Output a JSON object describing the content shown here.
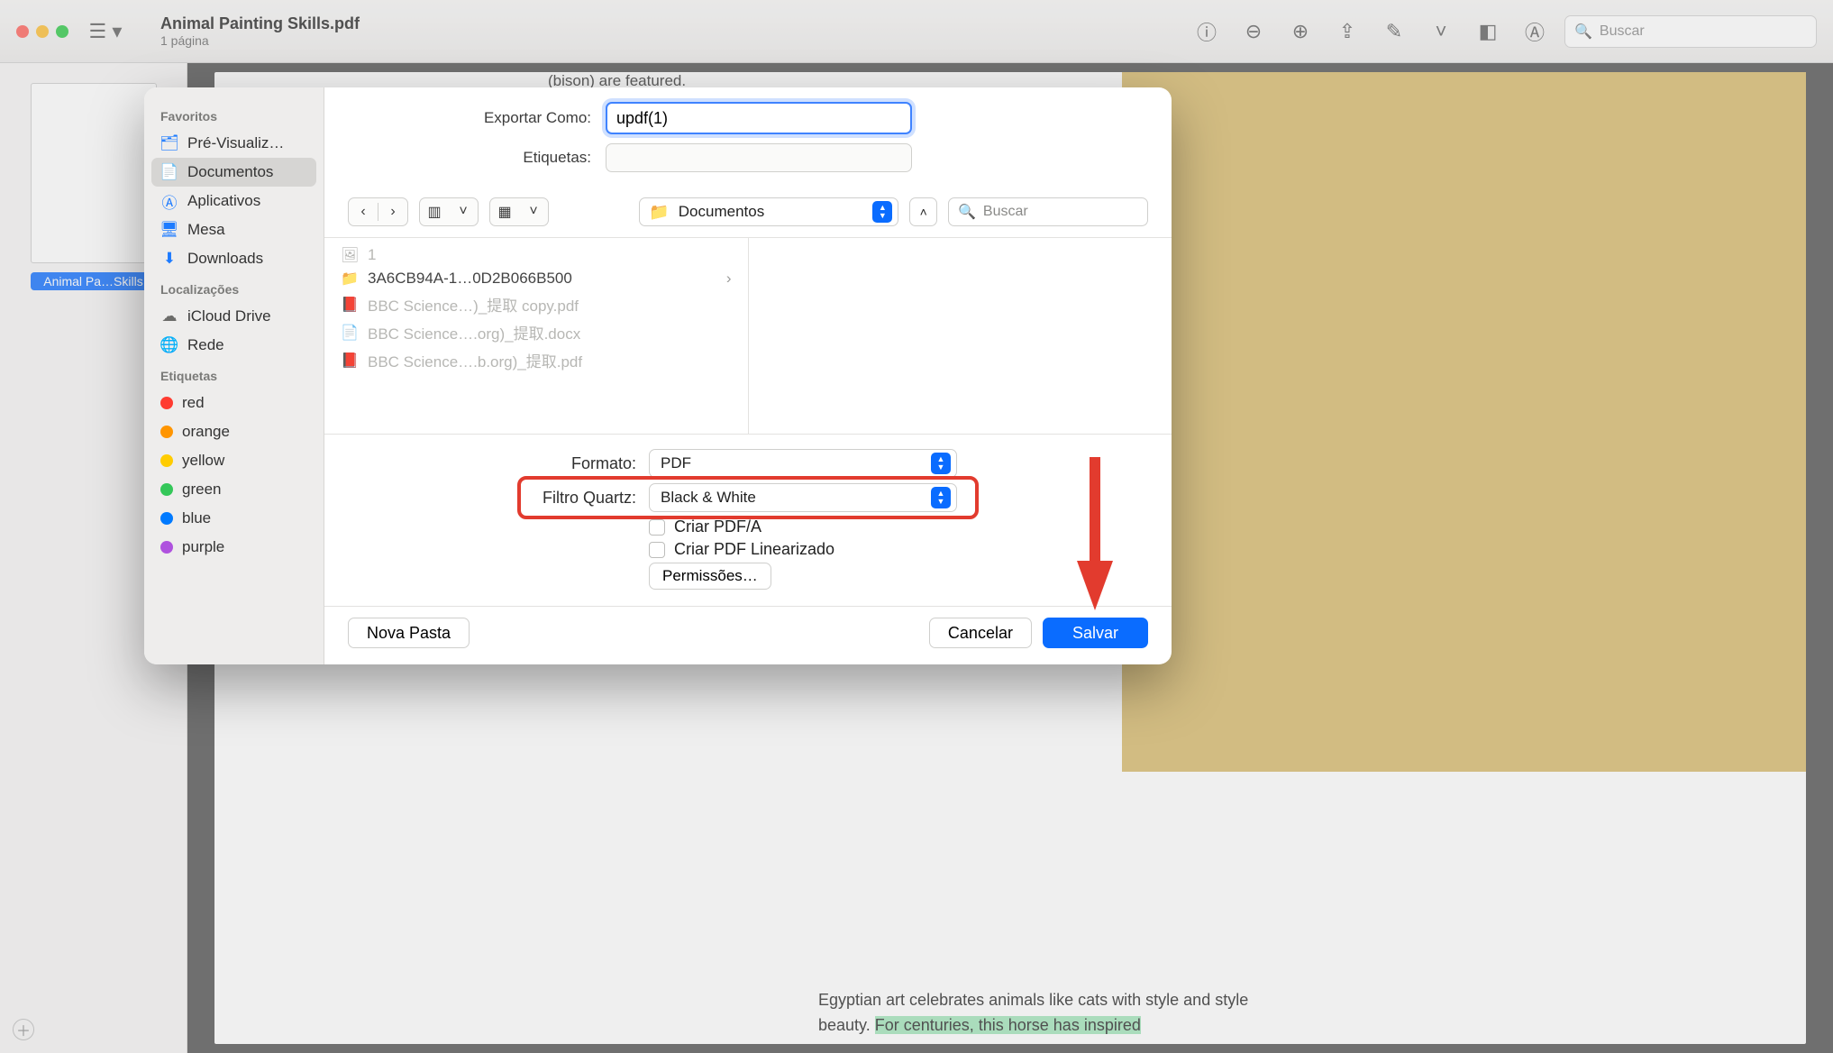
{
  "window": {
    "title": "Animal Painting Skills.pdf",
    "subtitle": "1 página",
    "search_placeholder": "Buscar",
    "thumb_label": "Animal Pa…Skills"
  },
  "page_text": {
    "snippet_top": "(bison) are featured.",
    "line1": "Egyptian art celebrates animals like cats with style and style",
    "line2a": "beauty. ",
    "line2b": "For centuries, this horse has inspired"
  },
  "dialog": {
    "export_label": "Exportar Como:",
    "filename": "updf(1)",
    "tags_label": "Etiquetas:",
    "location_label": "Documentos",
    "search_placeholder": "Buscar",
    "format_label": "Formato:",
    "format_value": "PDF",
    "quartz_label": "Filtro Quartz:",
    "quartz_value": "Black & White",
    "chk_pdfa": "Criar PDF/A",
    "chk_linear": "Criar PDF Linearizado",
    "permissions": "Permissões…",
    "new_folder": "Nova Pasta",
    "cancel": "Cancelar",
    "save": "Salvar"
  },
  "sidebar": {
    "favorites": "Favoritos",
    "items_fav": [
      "Pré-Visualiz…",
      "Documentos",
      "Aplicativos",
      "Mesa",
      "Downloads"
    ],
    "locations": "Localizações",
    "items_loc": [
      "iCloud Drive",
      "Rede"
    ],
    "tags": "Etiquetas",
    "items_tag": [
      "red",
      "orange",
      "yellow",
      "green",
      "blue",
      "purple"
    ]
  },
  "files": {
    "col1": [
      {
        "name": "1",
        "kind": "img",
        "dim": true
      },
      {
        "name": "3A6CB94A-1…0D2B066B500",
        "kind": "folder",
        "dim": false,
        "children": true
      },
      {
        "name": "BBC Science…)_提取 copy.pdf",
        "kind": "pdf",
        "dim": true
      },
      {
        "name": "BBC Science….org)_提取.docx",
        "kind": "doc",
        "dim": true
      },
      {
        "name": "BBC Science….b.org)_提取.pdf",
        "kind": "pdf",
        "dim": true
      }
    ]
  }
}
